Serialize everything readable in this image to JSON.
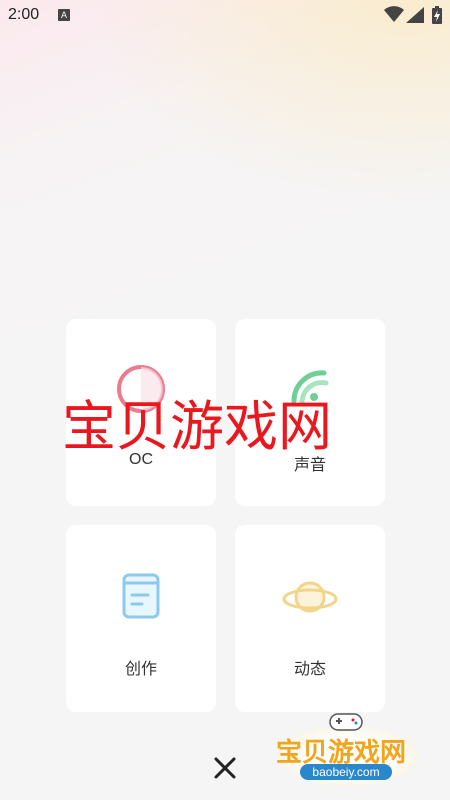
{
  "status_bar": {
    "time": "2:00",
    "notification_icon": "A"
  },
  "menu": {
    "items": [
      {
        "label": "OC",
        "icon": "circle-icon",
        "color": "#ec7b8d"
      },
      {
        "label": "声音",
        "icon": "sound-wave-icon",
        "color": "#6fcf97"
      },
      {
        "label": "创作",
        "icon": "notebook-icon",
        "color": "#8cc9ee"
      },
      {
        "label": "动态",
        "icon": "planet-icon",
        "color": "#f2d58a"
      }
    ]
  },
  "watermark": {
    "text": "宝贝游戏网",
    "logo_text": "宝贝游戏网",
    "logo_url": "baobeiy.com"
  },
  "close_icon": "close-icon"
}
